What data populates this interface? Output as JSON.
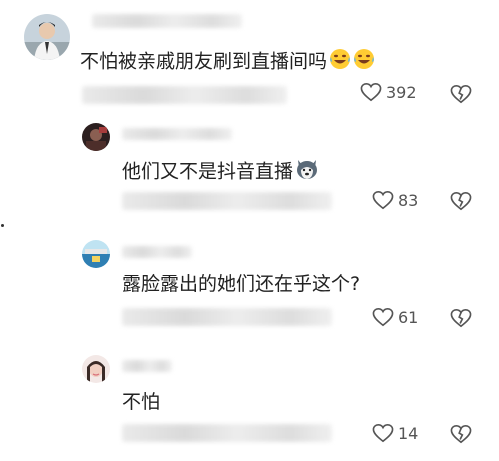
{
  "comments": [
    {
      "text": "不怕被亲戚朋友刷到直播间吗",
      "likes": "392",
      "emoji": "laugh-cry-emoji x2"
    },
    {
      "text": "他们又不是抖音直播",
      "likes": "83",
      "emoji": "husky-emoji"
    },
    {
      "text": "露脸露出的她们还在乎这个?",
      "likes": "61"
    },
    {
      "text": "不怕",
      "likes": "14"
    }
  ],
  "icons": {
    "like": "heart-outline-icon",
    "dislike": "broken-heart-icon"
  },
  "colors": {
    "text": "#222222",
    "icon": "#555555",
    "blur": "#dddddd"
  }
}
